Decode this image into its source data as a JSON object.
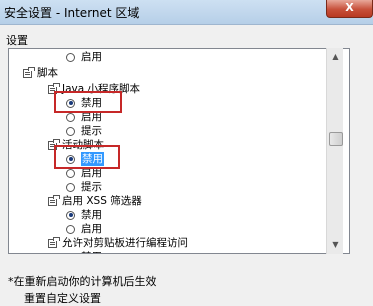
{
  "window": {
    "title": "安全设置 - Internet 区域",
    "close_glyph": "X"
  },
  "settings": {
    "label": "设置",
    "items": [
      {
        "type": "radio",
        "checked": false,
        "label": "启用"
      },
      {
        "type": "folder",
        "label": "脚本"
      },
      {
        "type": "folder",
        "label": "Java 小程序脚本"
      },
      {
        "type": "radio",
        "checked": true,
        "label": "禁用"
      },
      {
        "type": "radio",
        "checked": false,
        "label": "启用"
      },
      {
        "type": "radio",
        "checked": false,
        "label": "提示"
      },
      {
        "type": "folder",
        "label": "活动脚本"
      },
      {
        "type": "radio",
        "checked": true,
        "label": "禁用",
        "selected": true
      },
      {
        "type": "radio",
        "checked": false,
        "label": "启用"
      },
      {
        "type": "radio",
        "checked": false,
        "label": "提示"
      },
      {
        "type": "folder",
        "label": "启用 XSS 筛选器"
      },
      {
        "type": "radio",
        "checked": true,
        "label": "禁用"
      },
      {
        "type": "radio",
        "checked": false,
        "label": "启用"
      },
      {
        "type": "folder",
        "label": "允许对剪贴板进行编程访问"
      },
      {
        "type": "radio",
        "checked": false,
        "label": "禁用"
      }
    ]
  },
  "footer": {
    "note": "*在重新启动你的计算机后生效",
    "reset_label": "重置自定义设置"
  },
  "colors": {
    "highlight_box": "#c62828",
    "selection": "#3399ff"
  }
}
